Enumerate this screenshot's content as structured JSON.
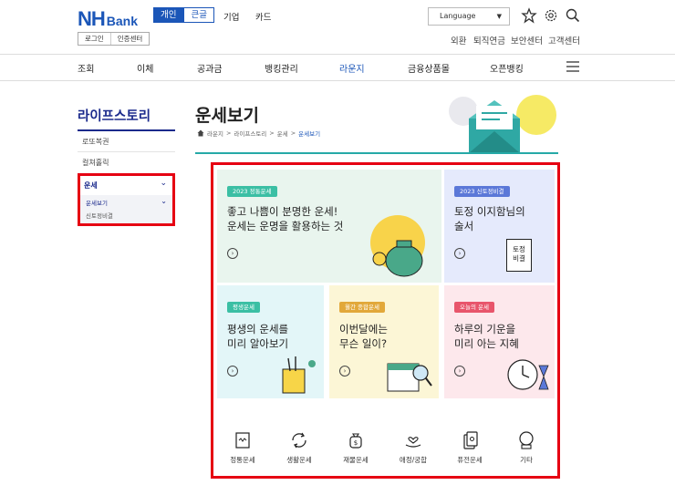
{
  "header": {
    "logo_nh": "NH",
    "logo_bank": "Bank",
    "segments": [
      "개인",
      "큰글"
    ],
    "links": [
      "기업",
      "카드"
    ],
    "login": "로그인",
    "cert": "인증센터",
    "language": "Language",
    "util_links": [
      "외환",
      "퇴직연금",
      "보안센터",
      "고객센터"
    ]
  },
  "gnb": [
    "조회",
    "이체",
    "공과금",
    "뱅킹관리",
    "라운지",
    "금융상품몰",
    "오픈뱅킹"
  ],
  "sidebar": {
    "title": "라이프스토리",
    "items": [
      "로또복권",
      "컬쳐홀릭"
    ],
    "active": "운세",
    "sub_active": "운세보기",
    "sub_other": "신토정비결"
  },
  "page": {
    "title": "운세보기",
    "breadcrumb": [
      "라운지",
      "라이프스토리",
      "운세",
      "운세보기"
    ]
  },
  "cards": [
    {
      "badge": "2023 정통운세",
      "text": "좋고 나쁨이 분명한 운세!\n운세는 운명을 활용하는 것",
      "badge_color": "#3bbfa4"
    },
    {
      "badge": "2023 신토정비결",
      "text": "토정 이지함님의\n술서",
      "badge_color": "#5b78d8",
      "icon_text": "토정\n비결"
    },
    {
      "badge": "평생운세",
      "text": "평생의 운세를\n미리 알아보기",
      "badge_color": "#3bbfa4"
    },
    {
      "badge": "월간 종합운세",
      "text": "이번달에는\n무슨 일이?",
      "badge_color": "#e2a83a"
    },
    {
      "badge": "오늘의 운세",
      "text": "하루의 기운을\n미리 아는 지혜",
      "badge_color": "#e8556b"
    }
  ],
  "categories": [
    "정통운세",
    "생활운세",
    "재물운세",
    "애정/궁합",
    "퓨전운세",
    "기타"
  ],
  "colors": {
    "brand": "#1b56b8",
    "highlight": "#e60012",
    "accent": "#26a9a7"
  }
}
